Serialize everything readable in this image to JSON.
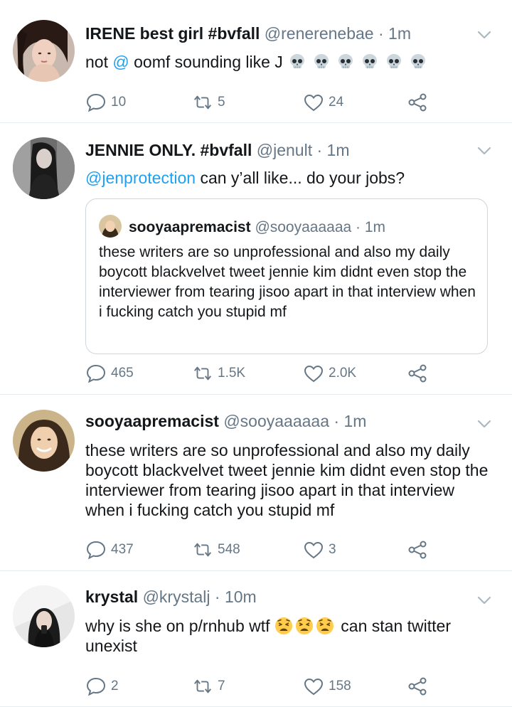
{
  "tweets": [
    {
      "name": "IRENE best girl #bvfall",
      "handle": "@renerenebae",
      "time": "1m",
      "text_link": "@",
      "text_pre": "not ",
      "text_post": " oomf sounding like J ",
      "emoji": "skull x6",
      "replies": "10",
      "retweets": "5",
      "likes": "24"
    },
    {
      "name": "JENNIE ONLY. #bvfall",
      "handle": "@jenult",
      "time": "1m",
      "text_link": "@jenprotection",
      "text_post": " can y’all like... do your jobs?",
      "quote": {
        "name": "sooyaapremacist",
        "handle": "@sooyaaaaaa",
        "time": "1m",
        "text": "these writers are so unprofessional and also my daily boycott blackvelvet tweet jennie kim didnt even stop the interviewer from tearing jisoo apart in that interview when i fucking catch you stupid mf"
      },
      "replies": "465",
      "retweets": "1.5K",
      "likes": "2.0K"
    },
    {
      "name": "sooyaapremacist",
      "handle": "@sooyaaaaaa",
      "time": "1m",
      "text": "these writers are so unprofessional and also my daily boycott blackvelvet tweet jennie kim didnt even stop the interviewer from tearing jisoo apart in that interview when i fucking catch you stupid mf",
      "replies": "437",
      "retweets": "548",
      "likes": "3"
    },
    {
      "name": "krystal",
      "handle": "@krystalj",
      "time": "10m",
      "text_pre": "why is she on p/rnhub wtf ",
      "emoji": "weary x3",
      "text_post": " can stan twitter unexist",
      "replies": "2",
      "retweets": "7",
      "likes": "158"
    }
  ],
  "meta_sep": " · ",
  "icons": [
    "reply-icon",
    "retweet-icon",
    "like-icon",
    "share-icon",
    "caret-down-icon"
  ],
  "colors": {
    "link": "#1da1f2",
    "secondary": "#657786",
    "divider": "#e6ecf0"
  }
}
